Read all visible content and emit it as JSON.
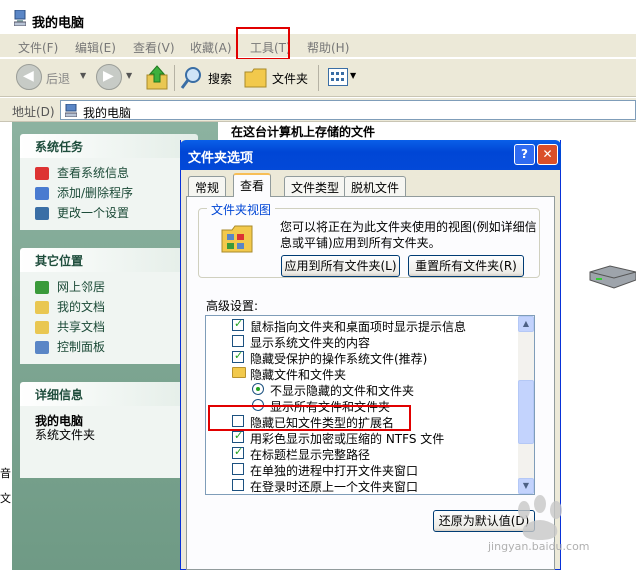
{
  "explorer": {
    "title": "我的电脑",
    "menu": [
      "文件(F)",
      "编辑(E)",
      "查看(V)",
      "收藏(A)",
      "工具(T)",
      "帮助(H)"
    ],
    "toolbar": {
      "back": "后退",
      "search": "搜索",
      "folders": "文件夹"
    },
    "address_label": "地址(D)",
    "address_value": "我的电脑",
    "content_heading": "在这台计算机上存储的文件",
    "edge_fragments": [
      "音",
      "文"
    ]
  },
  "sidebar": {
    "system_tasks": {
      "title": "系统任务",
      "items": [
        {
          "label": "查看系统信息",
          "icon": "system-info-icon"
        },
        {
          "label": "添加/删除程序",
          "icon": "add-remove-programs-icon"
        },
        {
          "label": "更改一个设置",
          "icon": "control-settings-icon"
        }
      ]
    },
    "other_places": {
      "title": "其它位置",
      "items": [
        {
          "label": "网上邻居",
          "icon": "network-icon"
        },
        {
          "label": "我的文档",
          "icon": "my-documents-icon"
        },
        {
          "label": "共享文档",
          "icon": "shared-documents-icon"
        },
        {
          "label": "控制面板",
          "icon": "control-panel-icon"
        }
      ]
    },
    "details": {
      "title": "详细信息",
      "name": "我的电脑",
      "type": "系统文件夹"
    }
  },
  "dialog": {
    "title": "文件夹选项",
    "help_btn": "?",
    "close_btn": "✕",
    "tabs": [
      "常规",
      "查看",
      "文件类型",
      "脱机文件"
    ],
    "active_tab": "查看",
    "folder_views": {
      "legend": "文件夹视图",
      "description": "您可以将正在为此文件夹使用的视图(例如详细信息或平铺)应用到所有文件夹。",
      "apply_all": "应用到所有文件夹(L)",
      "reset_all": "重置所有文件夹(R)"
    },
    "advanced_label": "高级设置:",
    "advanced_items": [
      {
        "type": "checkbox",
        "checked": true,
        "label": "鼠标指向文件夹和桌面项时显示提示信息"
      },
      {
        "type": "checkbox",
        "checked": false,
        "label": "显示系统文件夹的内容"
      },
      {
        "type": "checkbox",
        "checked": true,
        "label": "隐藏受保护的操作系统文件(推荐)"
      },
      {
        "type": "folder",
        "label": "隐藏文件和文件夹"
      },
      {
        "type": "radio",
        "checked": true,
        "label": "不显示隐藏的文件和文件夹"
      },
      {
        "type": "radio",
        "checked": false,
        "label": "显示所有文件和文件夹"
      },
      {
        "type": "checkbox",
        "checked": false,
        "label": "隐藏已知文件类型的扩展名"
      },
      {
        "type": "checkbox",
        "checked": true,
        "label": "用彩色显示加密或压缩的 NTFS 文件"
      },
      {
        "type": "checkbox",
        "checked": true,
        "label": "在标题栏显示完整路径"
      },
      {
        "type": "checkbox",
        "checked": false,
        "label": "在单独的进程中打开文件夹窗口"
      },
      {
        "type": "checkbox",
        "checked": false,
        "label": "在登录时还原上一个文件夹窗口"
      }
    ],
    "restore_defaults": "还原为默认值(D)"
  },
  "watermark": {
    "text": "jingyan.baidu.com"
  },
  "colors": {
    "highlight": "#E10000",
    "xp_blue": "#0046D5",
    "panel_green": "#7FA892"
  }
}
